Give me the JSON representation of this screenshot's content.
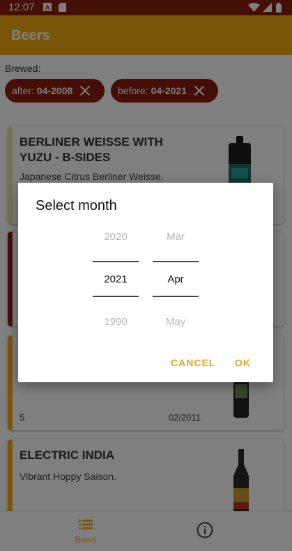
{
  "status_bar": {
    "time": "12:07"
  },
  "app_bar": {
    "title": "Beers"
  },
  "filters": {
    "label": "Brewed:",
    "after": {
      "prefix": "after:",
      "value": "04-2008"
    },
    "before": {
      "prefix": "before:",
      "value": "04-2021"
    }
  },
  "cards": [
    {
      "title": "BERLINER WEISSE WITH YUZU - B-SIDES",
      "description": "Japanese Citrus Berliner Weisse.",
      "stripe_color": "#e8e7a8"
    },
    {
      "stripe_color": "#8a1e10"
    },
    {
      "abv": "5",
      "first_brewed": "02/2011",
      "stripe_color": "#f5ad12"
    },
    {
      "title": "ELECTRIC INDIA",
      "description": "Vibrant Hoppy Saison.",
      "stripe_color": "#f5ad12"
    }
  ],
  "bottom_nav": {
    "beers_label": "Beers"
  },
  "dialog": {
    "title": "Select month",
    "years": {
      "prev": "2020",
      "selected": "2021",
      "next": "1990"
    },
    "months": {
      "prev": "Mar",
      "selected": "Apr",
      "next": "May"
    },
    "cancel_label": "CANCEL",
    "ok_label": "OK"
  },
  "colors": {
    "primary": "#f5ad12",
    "primary_dark": "#8a1e10",
    "accent": "#e8a317"
  }
}
